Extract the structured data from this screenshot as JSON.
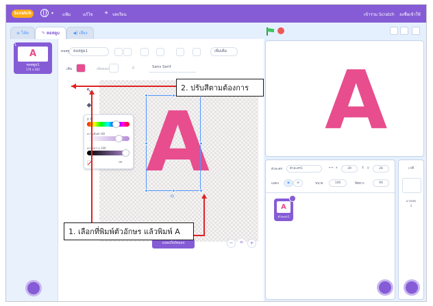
{
  "menubar": {
    "logo": "Scratch",
    "file": "แฟ้ม",
    "edit": "แก้ไข",
    "tutorials": "บทเรียน",
    "join": "เข้าร่วม Scratch",
    "signin": "ลงชื่อเข้าใช้"
  },
  "tabs": {
    "code": "โค้ด",
    "costumes": "คอสตูม",
    "sounds": "เสียง"
  },
  "costume_list": {
    "number": "1",
    "name": "คอสตูม1",
    "size": "174 x 242"
  },
  "editor": {
    "costume_name": "คอสตูม1",
    "fill_label": "เติม",
    "outline_label": "เส้นขอบ",
    "outline_width": "0",
    "font": "Sans Serif",
    "more_label": "เพิ่มเติม",
    "convert_button": "แปลงเป็นบิตแมป",
    "canvas_letter": "A"
  },
  "color_picker": {
    "hue_label": "สี  72",
    "saturation_label": "ความอิ่มตัว  80",
    "brightness_label": "ความสว่าง  100",
    "hue_value": 0.72,
    "saturation_value": 0.8,
    "brightness_value": 1.0,
    "selected_color": "#e84d8e"
  },
  "stage": {
    "letter": "A"
  },
  "sprite_info": {
    "sprite_label": "ตัวละคร",
    "sprite_name": "ตัวละคร1",
    "x_label": "x",
    "x_value": "39",
    "y_label": "y",
    "y_value": "28",
    "show_label": "แสดง",
    "size_label": "ขนาด",
    "size_value": "100",
    "direction_label": "ทิศทาง",
    "direction_value": "90",
    "sprite_tile_name": "ตัวละคร1",
    "sprite_tile_letter": "A"
  },
  "backdrop": {
    "stage_label": "เวที",
    "backdrops_label": "ฉากหลัง",
    "backdrops_count": "1"
  },
  "callouts": {
    "color": "2. ปรับสีตามต้องการ",
    "text": "1. เลือกที่พิมพ์ตัวอักษร แล้วพิมพ์ A"
  },
  "colors": {
    "scratch_purple": "#855cd6",
    "pink": "#e84d8e",
    "callout_arrow": "#e02020"
  }
}
